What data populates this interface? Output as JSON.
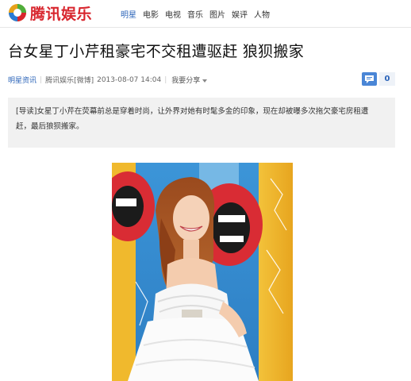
{
  "header": {
    "logo_text": "腾讯娱乐",
    "nav": [
      "明星",
      "电影",
      "电视",
      "音乐",
      "图片",
      "娱评",
      "人物"
    ],
    "active_nav": "明星",
    "brand_color": "#d8262e",
    "link_color": "#2a63b8"
  },
  "article": {
    "title": "台女星丁小芹租豪宅不交租遭驱赶 狼狈搬家",
    "meta": {
      "channel": "明星资讯",
      "source": "腾讯娱乐[微博]",
      "datetime": "2013-08-07 14:04",
      "share_label": "我要分享"
    },
    "comment_count": "0",
    "summary": "[导读]女星丁小芹在荧幕前总是穿着时尚，让外界对她有时髦多金的印象，现在却被曝多次拖欠豪宅房租遭赶，最后狼狈搬家。"
  },
  "icons": {
    "logo": "tencent-logo-icon",
    "comment": "comment-bubble-icon",
    "share_caret": "caret-down-icon"
  }
}
